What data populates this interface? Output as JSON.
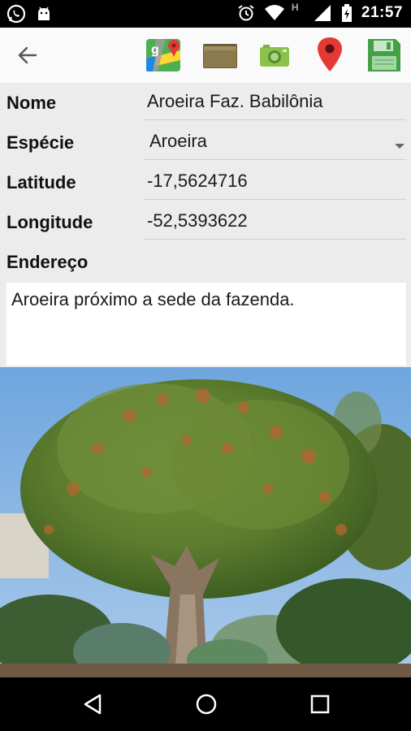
{
  "status_bar": {
    "time": "21:57",
    "left_icons": [
      "whatsapp-icon",
      "android-icon"
    ],
    "right_icons": [
      "alarm-icon",
      "wifi-icon",
      "h-network-icon",
      "signal-icon",
      "battery-icon"
    ],
    "network_label": "H"
  },
  "action_bar": {
    "back_icon": "arrow-back-icon",
    "actions": [
      {
        "name": "google-maps-icon"
      },
      {
        "name": "folder-icon"
      },
      {
        "name": "camera-icon"
      },
      {
        "name": "location-pin-icon"
      },
      {
        "name": "save-icon"
      }
    ]
  },
  "form": {
    "nome_label": "Nome",
    "nome_value": "Aroeira Faz.  Babilônia",
    "especie_label": "Espécie",
    "especie_value": "Aroeira",
    "latitude_label": "Latitude",
    "latitude_value": "-17,5624716",
    "longitude_label": "Longitude",
    "longitude_value": "-52,5393622",
    "endereco_label": "Endereço",
    "endereco_value": "Aroeira próximo a sede da fazenda."
  },
  "photo": {
    "subject": "tree"
  },
  "nav_bar": {
    "buttons": [
      "back-triangle-icon",
      "home-circle-icon",
      "recents-square-icon"
    ]
  },
  "colors": {
    "status_bar_bg": "#000000",
    "action_bar_bg": "#fafafa",
    "form_bg": "#ececec",
    "field_underline": "#cfcfcf",
    "pin_red": "#e53935",
    "save_green": "#4caf50"
  }
}
